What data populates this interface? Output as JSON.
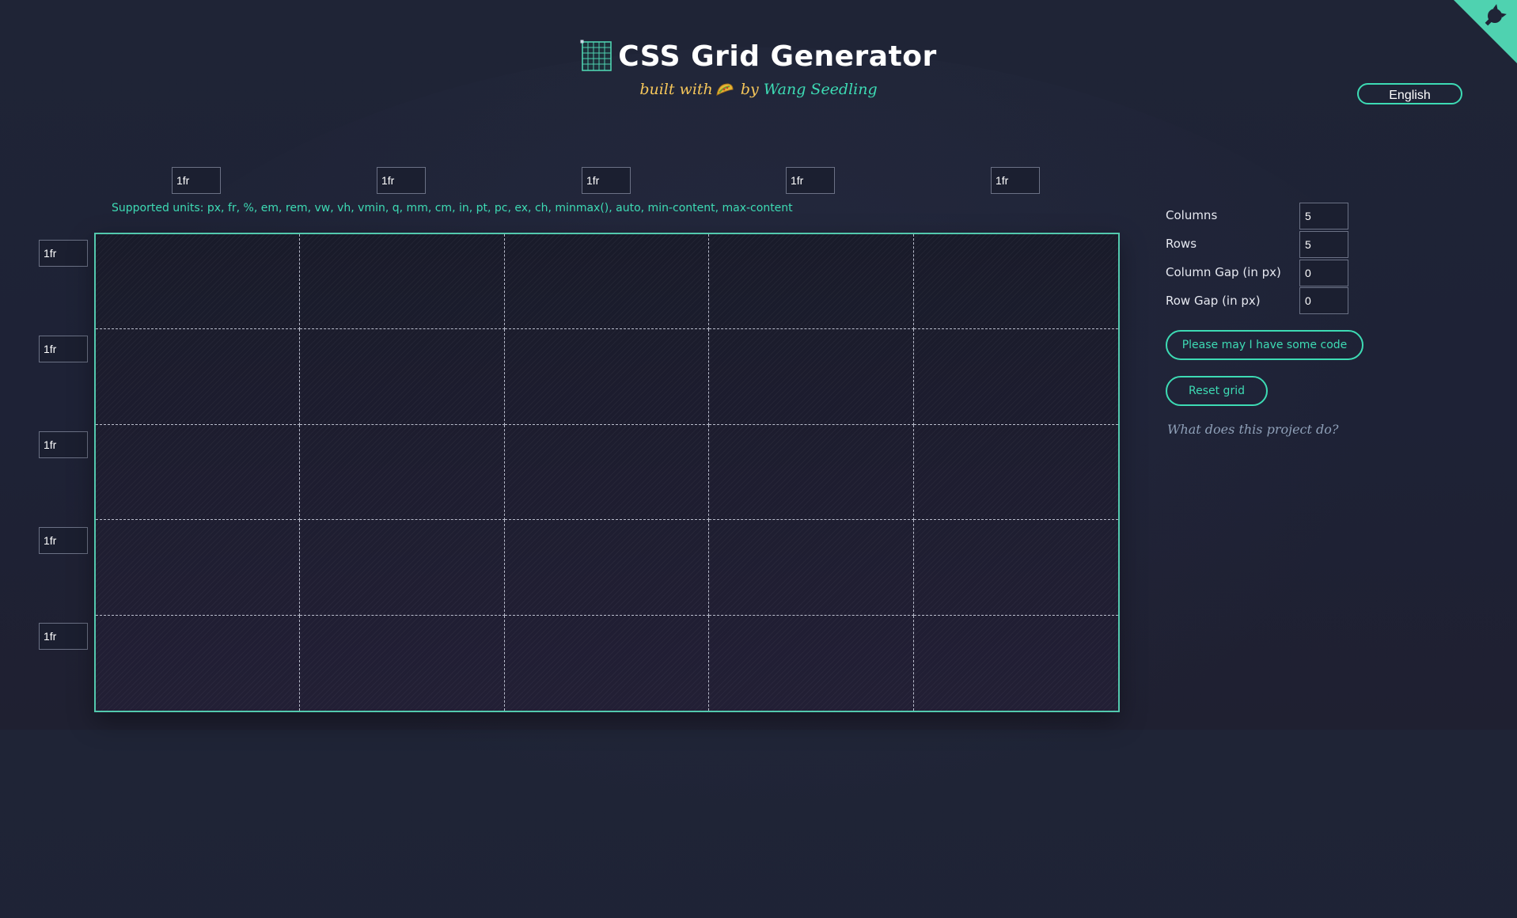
{
  "header": {
    "title": "CSS Grid Generator",
    "subtitle_prefix": "built with",
    "subtitle_by": "by",
    "author": "Wang Seedling"
  },
  "language": {
    "label": "English"
  },
  "columns_sizes": [
    "1fr",
    "1fr",
    "1fr",
    "1fr",
    "1fr"
  ],
  "rows_sizes": [
    "1fr",
    "1fr",
    "1fr",
    "1fr",
    "1fr"
  ],
  "units_hint": "Supported units: px, fr, %, em, rem, vw, vh, vmin, q, mm, cm, in, pt, pc, ex, ch, minmax(), auto, min-content, max-content",
  "controls": {
    "columns": {
      "label": "Columns",
      "value": "5"
    },
    "rows": {
      "label": "Rows",
      "value": "5"
    },
    "column_gap": {
      "label": "Column Gap (in px)",
      "value": "0"
    },
    "row_gap": {
      "label": "Row Gap (in px)",
      "value": "0"
    }
  },
  "buttons": {
    "code": "Please may I have some code",
    "reset": "Reset grid"
  },
  "help_link": "What does this project do?",
  "colors": {
    "accent": "#3ddbb4",
    "title_yellow": "#f5c65a",
    "background": "#1f2436"
  },
  "icons": {
    "logo": "grid-logo-icon",
    "taco": "taco-icon",
    "corner": "github-octocat-icon"
  }
}
